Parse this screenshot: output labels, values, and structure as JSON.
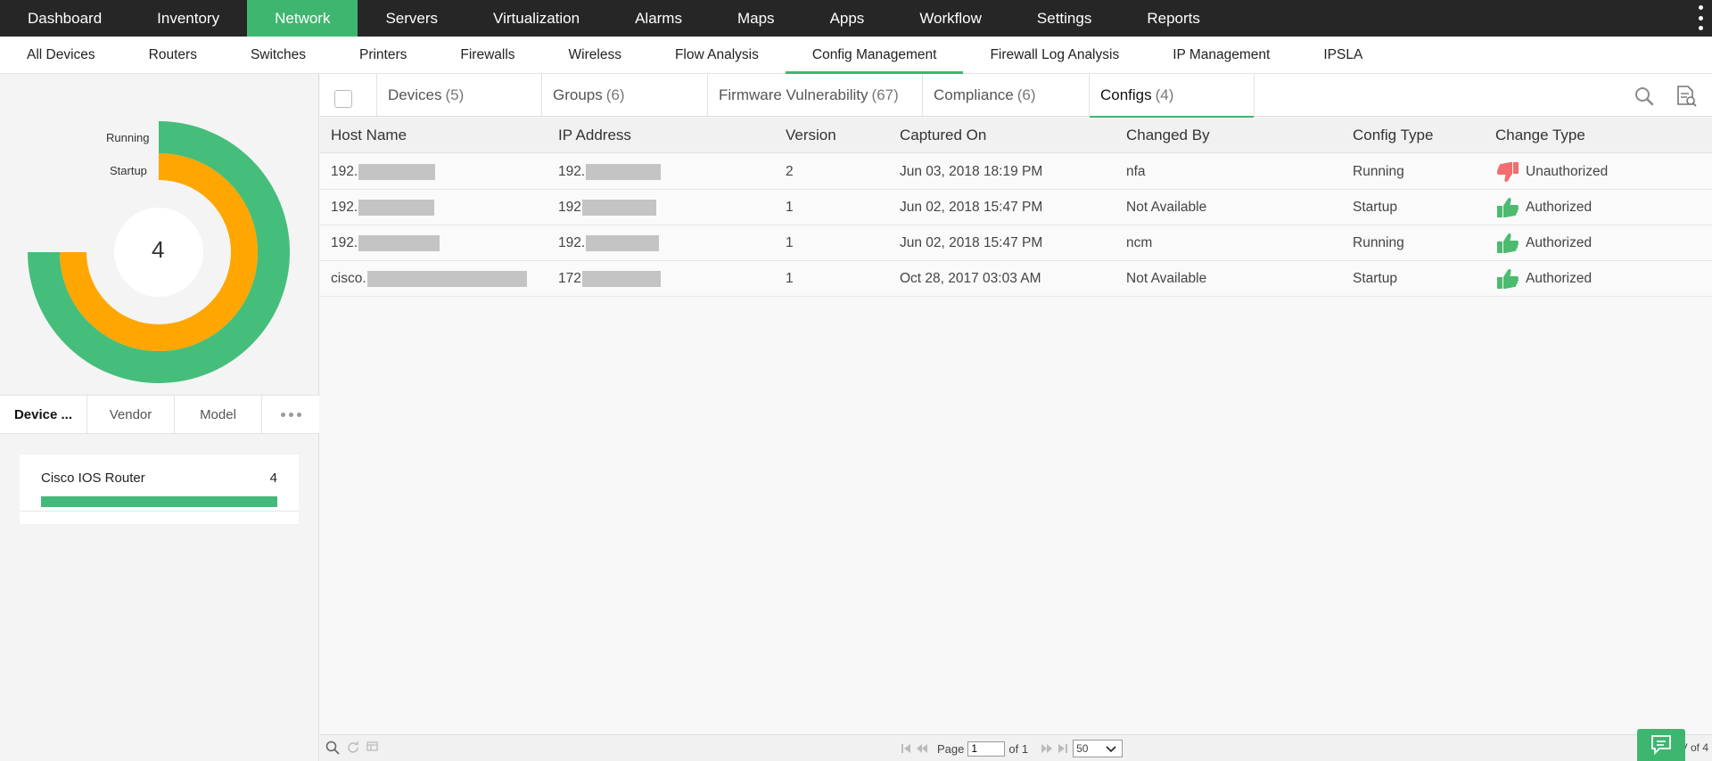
{
  "topnav": {
    "items": [
      {
        "label": "Dashboard",
        "active": false
      },
      {
        "label": "Inventory",
        "active": false
      },
      {
        "label": "Network",
        "active": true
      },
      {
        "label": "Servers",
        "active": false
      },
      {
        "label": "Virtualization",
        "active": false
      },
      {
        "label": "Alarms",
        "active": false
      },
      {
        "label": "Maps",
        "active": false
      },
      {
        "label": "Apps",
        "active": false
      },
      {
        "label": "Workflow",
        "active": false
      },
      {
        "label": "Settings",
        "active": false
      },
      {
        "label": "Reports",
        "active": false
      }
    ]
  },
  "subnav": {
    "items": [
      {
        "label": "All Devices",
        "active": false
      },
      {
        "label": "Routers",
        "active": false
      },
      {
        "label": "Switches",
        "active": false
      },
      {
        "label": "Printers",
        "active": false
      },
      {
        "label": "Firewalls",
        "active": false
      },
      {
        "label": "Wireless",
        "active": false
      },
      {
        "label": "Flow Analysis",
        "active": false
      },
      {
        "label": "Config Management",
        "active": true
      },
      {
        "label": "Firewall Log Analysis",
        "active": false
      },
      {
        "label": "IP Management",
        "active": false
      },
      {
        "label": "IPSLA",
        "active": false
      }
    ]
  },
  "donut": {
    "center_value": "4",
    "rings": [
      {
        "label": "Running",
        "fraction": 0.75,
        "color": "#45be7b"
      },
      {
        "label": "Startup",
        "fraction": 0.75,
        "color": "#ffa600"
      }
    ]
  },
  "left_tabs": {
    "items": [
      {
        "label": "Device ...",
        "active": true
      },
      {
        "label": "Vendor",
        "active": false
      },
      {
        "label": "Model",
        "active": false
      }
    ]
  },
  "model_card": {
    "name": "Cisco IOS Router",
    "count": "4",
    "fill": 1.0,
    "color": "#45b97a"
  },
  "tabs": [
    {
      "label": "Devices",
      "count": "(5)",
      "active": false
    },
    {
      "label": "Groups",
      "count": "(6)",
      "active": false
    },
    {
      "label": "Firmware Vulnerability",
      "count": "(67)",
      "active": false
    },
    {
      "label": "Compliance",
      "count": "(6)",
      "active": false
    },
    {
      "label": "Configs",
      "count": "(4)",
      "active": true
    }
  ],
  "table": {
    "columns": [
      "Host Name",
      "IP Address",
      "Version",
      "Captured On",
      "Changed By",
      "Config Type",
      "Change Type"
    ],
    "rows": [
      {
        "host": "192.",
        "ip": "192.",
        "version": "2",
        "captured": "Jun 03, 2018 18:19 PM",
        "changed_by": "nfa",
        "config_type": "Running",
        "change_type": "Unauthorized",
        "status": "unauthorized"
      },
      {
        "host": "192.",
        "ip": "192",
        "version": "1",
        "captured": "Jun 02, 2018 15:47 PM",
        "changed_by": "Not Available",
        "config_type": "Startup",
        "change_type": "Authorized",
        "status": "authorized"
      },
      {
        "host": "192.",
        "ip": "192.",
        "version": "1",
        "captured": "Jun 02, 2018 15:47 PM",
        "changed_by": "ncm",
        "config_type": "Running",
        "change_type": "Authorized",
        "status": "authorized"
      },
      {
        "host": "cisco.",
        "ip": "172",
        "version": "1",
        "captured": "Oct 28, 2017 03:03 AM",
        "changed_by": "Not Available",
        "config_type": "Startup",
        "change_type": "Authorized",
        "status": "authorized"
      }
    ]
  },
  "pager": {
    "page_label": "Page",
    "page_value": "1",
    "of_label": "of 1",
    "per_page": "50",
    "view_text": "V  of 4"
  },
  "colors": {
    "accent": "#3fb66f",
    "authorized": "#4cbb6f",
    "unauthorized": "#f26d6d"
  }
}
